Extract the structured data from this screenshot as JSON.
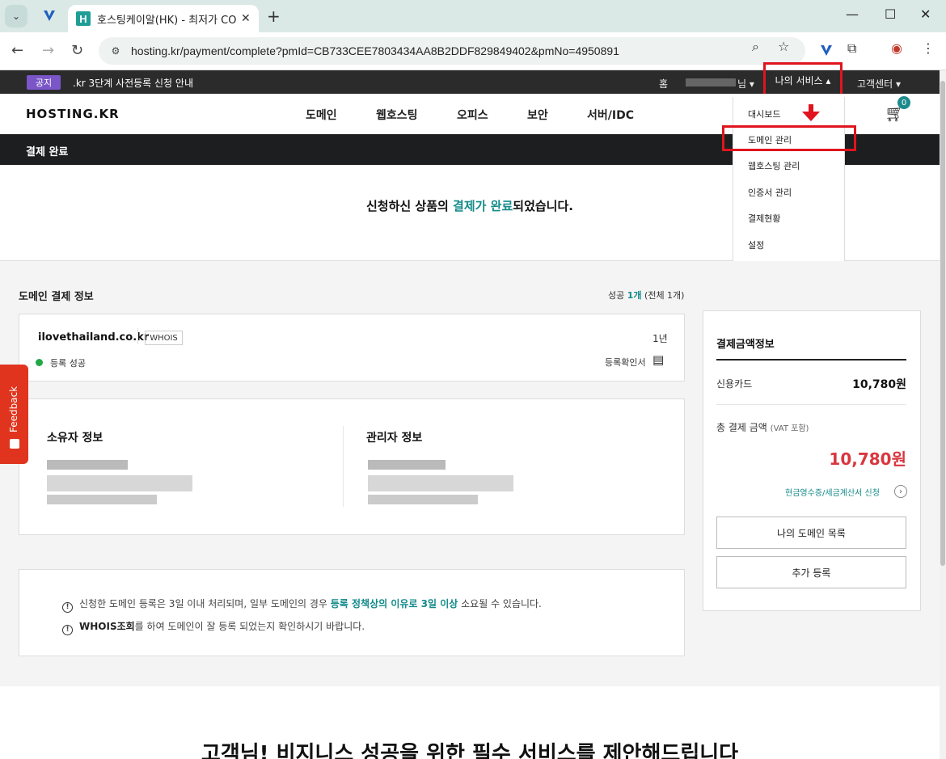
{
  "browser": {
    "tab_title": "호스팅케이알(HK) - 최저가 CO",
    "tab_close": "✕",
    "new_tab": "+",
    "url": "hosting.kr/payment/complete?pmId=CB733CEE7803434AA8B2DDF829849402&pmNo=4950891",
    "minimize": "—",
    "maximize": "☐",
    "close": "✕"
  },
  "notice": {
    "badge": "공지",
    "text": ".kr 3단계 사전등록 신청 안내"
  },
  "top_links": {
    "home": "홈",
    "user_suffix": "님 ▾",
    "my_service": "나의 서비스 ▴",
    "support": "고객센터 ▾"
  },
  "header": {
    "logo": "HOSTING.KR",
    "nav": [
      "도메인",
      "웹호스팅",
      "오피스",
      "보안",
      "서버/IDC"
    ],
    "cart_count": "0"
  },
  "page_title": "결제 완료",
  "dropdown": {
    "items": [
      "대시보드",
      "도메인 관리",
      "웹호스팅 관리",
      "인증서 관리",
      "결제현황",
      "설정"
    ]
  },
  "hero": {
    "pre": "신청하신 상품의 ",
    "highlight": "결제가 완료",
    "post": "되었습니다."
  },
  "domain_info": {
    "title": "도메인 결제 정보",
    "success_label": "성공 ",
    "success_count": "1개",
    "total": " (전체 1개)",
    "domain": "ilovethailand.co.kr",
    "whois": "WHOIS",
    "period": "1년",
    "status": "등록 성공",
    "certificate": "등록확인서"
  },
  "contacts": {
    "owner_title": "소유자 정보",
    "admin_title": "관리자 정보"
  },
  "notes": {
    "line1_pre": "신청한 도메인 등록은 3일 이내 처리되며, 일부 도메인의 경우 ",
    "line1_hl": "등록 정책상의 이유로 3일 이상",
    "line1_post": " 소요될 수 있습니다.",
    "line2_bold": "WHOIS조회",
    "line2_post": "를 하여 도메인이 잘 등록 되었는지 확인하시기 바랍니다."
  },
  "payment": {
    "title": "결제금액정보",
    "card_label": "신용카드",
    "card_value": "10,780원",
    "total_label": "총 결제 금액",
    "vat_note": "(VAT 포함)",
    "total_value": "10,780원",
    "receipt_link": "현금영수증/세금계산서 신청",
    "btn_my_domains": "나의 도메인 목록",
    "btn_add": "추가 등록"
  },
  "feedback": "Feedback",
  "bottom_heading": "고객님! 비지니스 성공을 위한 필수 서비스를 제안해드립니다",
  "colors": {
    "accent": "#148a8a",
    "highlight_box": "#e0141e",
    "price": "#d9363e"
  }
}
